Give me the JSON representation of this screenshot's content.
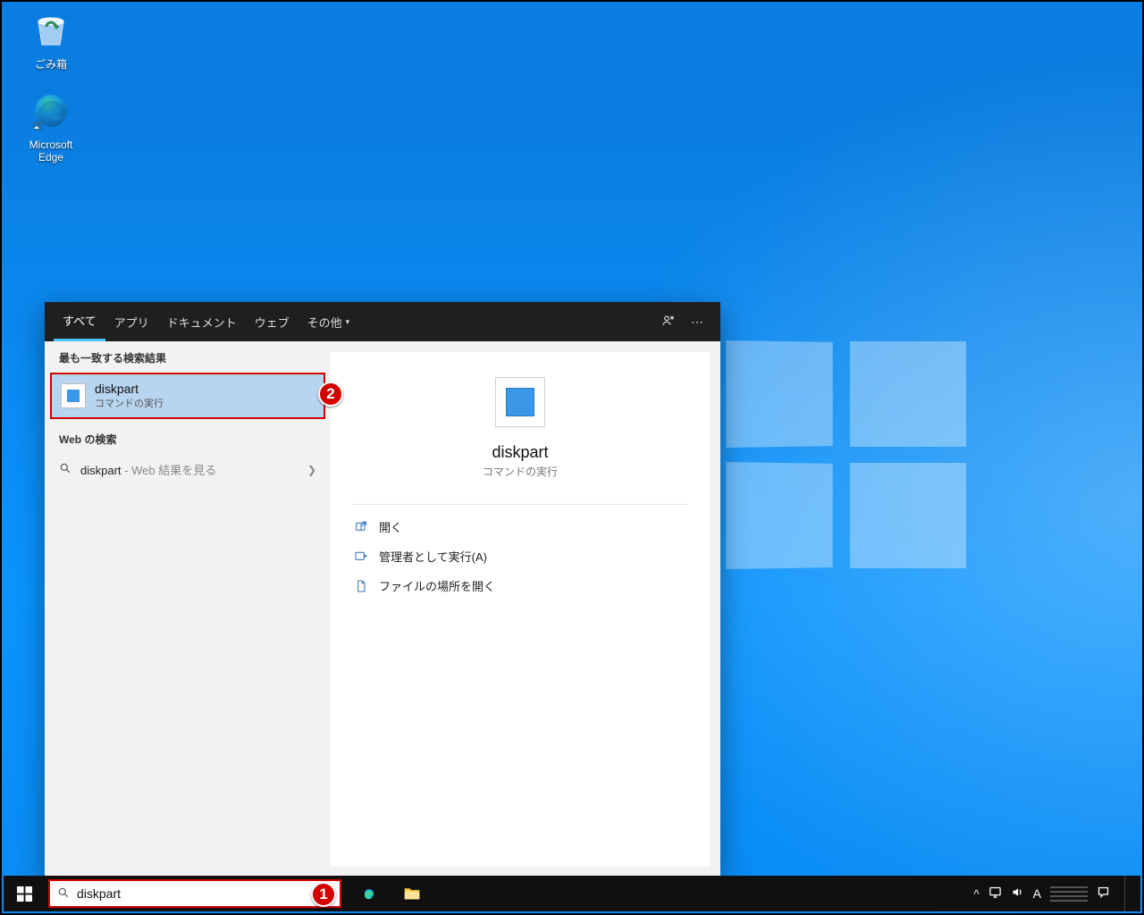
{
  "desktop_icons": {
    "recycle_bin": "ごみ箱",
    "edge": "Microsoft Edge"
  },
  "tabs": {
    "all": "すべて",
    "apps": "アプリ",
    "docs": "ドキュメント",
    "web": "ウェブ",
    "more": "その他"
  },
  "left": {
    "best_header": "最も一致する検索結果",
    "best_title": "diskpart",
    "best_sub": "コマンドの実行",
    "web_header": "Web の検索",
    "web_prefix": "diskpart",
    "web_suffix": " - Web 結果を見る"
  },
  "detail": {
    "title": "diskpart",
    "sub": "コマンドの実行",
    "open": "開く",
    "admin": "管理者として実行(A)",
    "loc": "ファイルの場所を開く"
  },
  "search": {
    "value": "diskpart",
    "placeholder": ""
  },
  "annotations": {
    "one": "1",
    "two": "2"
  },
  "tray": {
    "ime": "A"
  }
}
